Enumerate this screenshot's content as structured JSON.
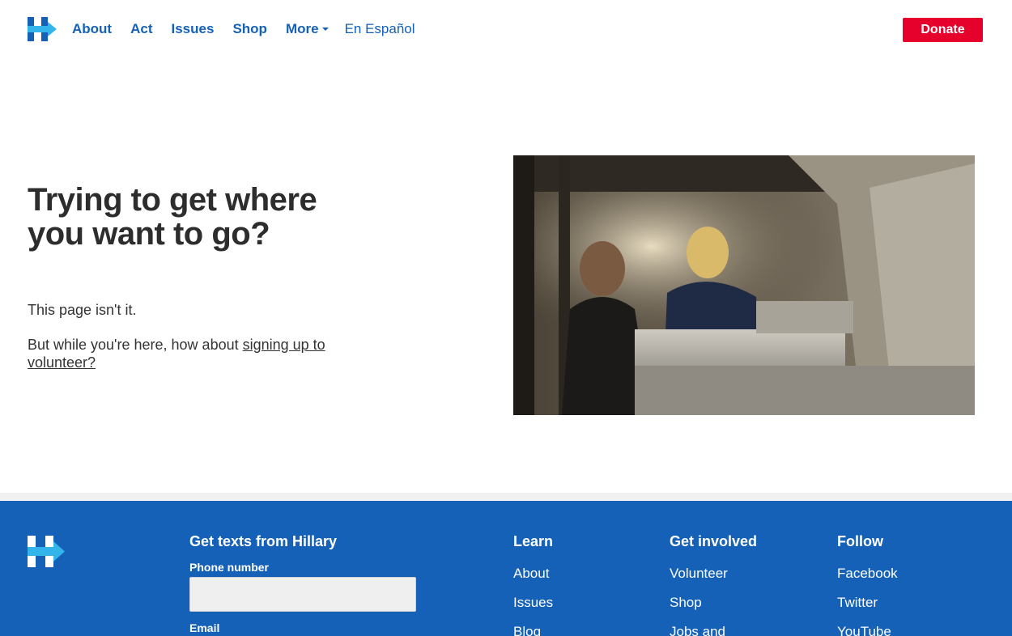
{
  "header": {
    "nav": [
      {
        "label": "About"
      },
      {
        "label": "Act"
      },
      {
        "label": "Issues"
      },
      {
        "label": "Shop"
      },
      {
        "label": "More"
      }
    ],
    "spanish_label": "En Español",
    "donate_label": "Donate"
  },
  "main": {
    "headline": "Trying to get where you want to go?",
    "line1": "This page isn't it.",
    "line2_prefix": "But while you're here, how about ",
    "line2_link": "signing up to volunteer?"
  },
  "footer": {
    "texts_title": "Get texts from Hillary",
    "phone_label": "Phone number",
    "email_label": "Email",
    "learn": {
      "title": "Learn",
      "items": [
        "About",
        "Issues",
        "Blog"
      ]
    },
    "involved": {
      "title": "Get involved",
      "items": [
        "Volunteer",
        "Shop",
        "Jobs and"
      ]
    },
    "follow": {
      "title": "Follow",
      "items": [
        "Facebook",
        "Twitter",
        "YouTube"
      ]
    }
  },
  "colors": {
    "brand_blue": "#1561b8",
    "accent_cyan": "#33b5ec",
    "donate_red": "#e6002c"
  }
}
